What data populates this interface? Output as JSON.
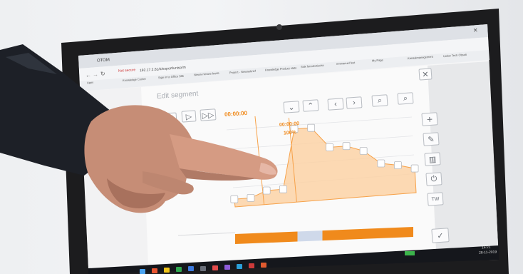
{
  "browser": {
    "tab_title": "OTOM",
    "url_warning": "Not secure",
    "url": "192.17.2.81/#/export/uniso/m",
    "bookmarks": [
      "Apps",
      "Knowledge Center",
      "Sign in to Office 365",
      "Nieuw nieuws feeds",
      "Project - Nieuwsbrief",
      "Knowledge Product stats",
      "Sisk ferrolectischa",
      "emmanuel fest",
      "My Page",
      "Kanaalmanegement",
      "Under Tech Obsoti"
    ]
  },
  "editor": {
    "title": "Edit segment",
    "time_display": "00:00:00",
    "marker_time": "00:00:00",
    "marker_percent": "100%",
    "side_buttons": [
      "+",
      "pencil",
      "trash",
      "power",
      "TW"
    ],
    "confirm_icon": "check-icon",
    "close_icon": "close-icon"
  },
  "chart_data": {
    "type": "area",
    "title": "",
    "xlabel": "",
    "ylabel": "",
    "x": [
      0,
      1,
      2,
      3,
      4,
      5,
      6,
      7,
      8,
      9,
      10,
      11
    ],
    "values": [
      10,
      10,
      18,
      18,
      95,
      95,
      68,
      68,
      60,
      42,
      38,
      32
    ],
    "ylim": [
      0,
      100
    ],
    "grid": true
  },
  "timeline": {
    "colors": [
      "#f08a1c",
      "#cfd9ea",
      "#f08a1c"
    ],
    "fractions": [
      0.35,
      0.14,
      0.51
    ]
  },
  "taskbar": {
    "time": "16:21",
    "date": "28-11-2019"
  },
  "colors": {
    "accent": "#f7a24a",
    "fill": "#fcd2a6",
    "bezel": "#1c1c1e",
    "taskbar": "#15171c"
  }
}
